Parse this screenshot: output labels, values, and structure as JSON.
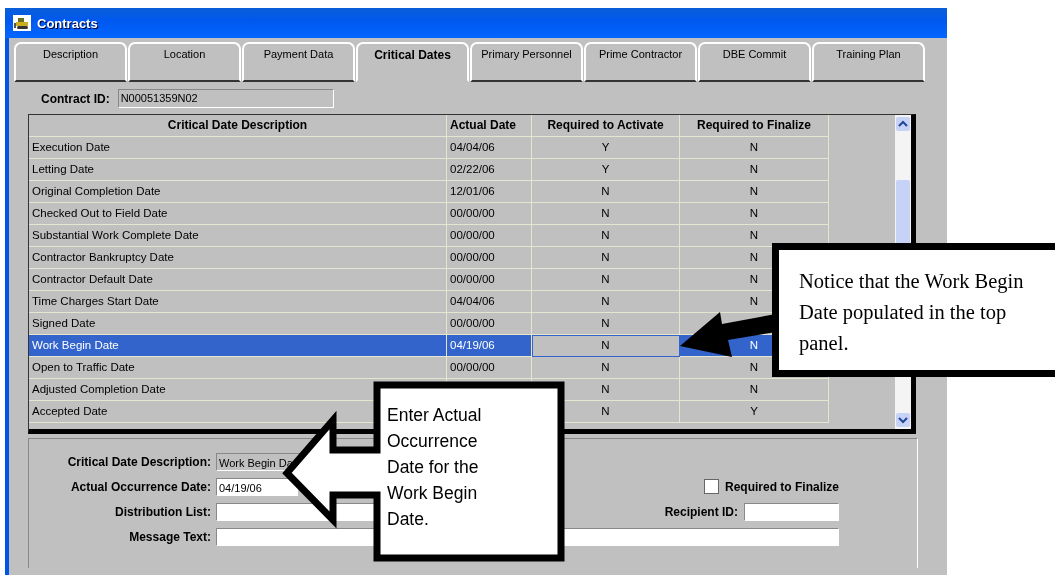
{
  "window": {
    "title": "Contracts"
  },
  "tabs": [
    {
      "label": "Description",
      "selected": false
    },
    {
      "label": "Location",
      "selected": false
    },
    {
      "label": "Payment Data",
      "selected": false
    },
    {
      "label": "Critical Dates",
      "selected": true
    },
    {
      "label": "Primary Personnel",
      "selected": false
    },
    {
      "label": "Prime Contractor",
      "selected": false
    },
    {
      "label": "DBE Commit",
      "selected": false
    },
    {
      "label": "Training Plan",
      "selected": false
    }
  ],
  "contract_id": {
    "label": "Contract ID:",
    "value": "N00051359N02"
  },
  "table": {
    "columns": [
      "Critical Date Description",
      "Actual Date",
      "Required to Activate",
      "Required to Finalize"
    ],
    "rows": [
      {
        "description": "Execution Date",
        "actual_date": "04/04/06",
        "required_to_activate": "Y",
        "required_to_finalize": "N",
        "selected": false
      },
      {
        "description": "Letting Date",
        "actual_date": "02/22/06",
        "required_to_activate": "Y",
        "required_to_finalize": "N",
        "selected": false
      },
      {
        "description": "Original Completion Date",
        "actual_date": "12/01/06",
        "required_to_activate": "N",
        "required_to_finalize": "N",
        "selected": false
      },
      {
        "description": "Checked Out to Field Date",
        "actual_date": "00/00/00",
        "required_to_activate": "N",
        "required_to_finalize": "N",
        "selected": false
      },
      {
        "description": "Substantial Work Complete Date",
        "actual_date": "00/00/00",
        "required_to_activate": "N",
        "required_to_finalize": "N",
        "selected": false
      },
      {
        "description": "Contractor Bankruptcy Date",
        "actual_date": "00/00/00",
        "required_to_activate": "N",
        "required_to_finalize": "N",
        "selected": false
      },
      {
        "description": "Contractor Default Date",
        "actual_date": "00/00/00",
        "required_to_activate": "N",
        "required_to_finalize": "N",
        "selected": false
      },
      {
        "description": "Time Charges Start Date",
        "actual_date": "04/04/06",
        "required_to_activate": "N",
        "required_to_finalize": "N",
        "selected": false
      },
      {
        "description": "Signed Date",
        "actual_date": "00/00/00",
        "required_to_activate": "N",
        "selected": false
      },
      {
        "description": "Work Begin Date",
        "actual_date": "04/19/06",
        "required_to_activate": "N",
        "required_to_finalize": "N",
        "selected": true
      },
      {
        "description": "Open to Traffic Date",
        "actual_date": "00/00/00",
        "required_to_activate": "N",
        "required_to_finalize": "N",
        "selected": false
      },
      {
        "description": "Adjusted Completion Date",
        "required_to_activate": "N",
        "required_to_finalize": "N",
        "selected": false
      },
      {
        "description": "Accepted Date",
        "required_to_activate": "N",
        "required_to_finalize": "Y",
        "selected": false
      }
    ]
  },
  "detail": {
    "critical_date_description": {
      "label": "Critical Date Description:",
      "value": "Work Begin Da"
    },
    "actual_occurrence_date": {
      "label": "Actual Occurrence Date:",
      "value": "04/19/06"
    },
    "required_to_finalize": {
      "label": "Required to Finalize",
      "checked": false
    },
    "distribution_list": {
      "label": "Distribution List:"
    },
    "recipient_id": {
      "label": "Recipient ID:"
    },
    "message_text": {
      "label": "Message Text:"
    }
  },
  "callouts": [
    {
      "kind": "block-arrow",
      "text": "Enter Actual Occurrence Date for the Work Begin Date."
    },
    {
      "kind": "pointer",
      "text": "Notice that the Work Begin Date populated in the top panel."
    }
  ]
}
